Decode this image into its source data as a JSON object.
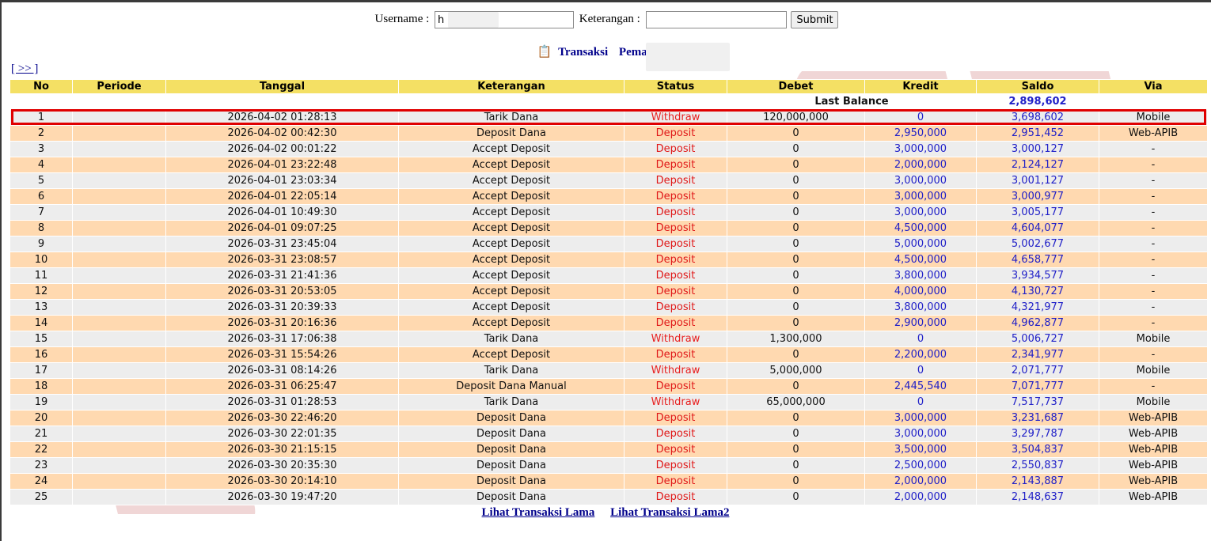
{
  "search": {
    "username_label": "Username :",
    "username_value": "h",
    "keterangan_label": "Keterangan :",
    "keterangan_value": "",
    "submit_label": "Submit"
  },
  "title": {
    "transaksi": "Transaksi",
    "pemain_label": "Pemain : h"
  },
  "nav": {
    "next_label": "[ >> ]"
  },
  "table": {
    "headers": [
      "No",
      "Periode",
      "Tanggal",
      "Keterangan",
      "Status",
      "Debet",
      "Kredit",
      "Saldo",
      "Via"
    ],
    "last_balance_label": "Last Balance",
    "last_balance_value": "2,898,602",
    "rows": [
      {
        "no": "1",
        "periode": "",
        "tanggal": "2026-04-02 01:28:13",
        "keterangan": "Tarik Dana",
        "status": "Withdraw",
        "debet": "120,000,000",
        "kredit": "0",
        "saldo": "3,698,602",
        "via": "Mobile"
      },
      {
        "no": "2",
        "periode": "",
        "tanggal": "2026-04-02 00:42:30",
        "keterangan": "Deposit Dana",
        "status": "Deposit",
        "debet": "0",
        "kredit": "2,950,000",
        "saldo": "2,951,452",
        "via": "Web-APIB"
      },
      {
        "no": "3",
        "periode": "",
        "tanggal": "2026-04-02 00:01:22",
        "keterangan": "Accept Deposit",
        "status": "Deposit",
        "debet": "0",
        "kredit": "3,000,000",
        "saldo": "3,000,127",
        "via": "-"
      },
      {
        "no": "4",
        "periode": "",
        "tanggal": "2026-04-01 23:22:48",
        "keterangan": "Accept Deposit",
        "status": "Deposit",
        "debet": "0",
        "kredit": "2,000,000",
        "saldo": "2,124,127",
        "via": "-"
      },
      {
        "no": "5",
        "periode": "",
        "tanggal": "2026-04-01 23:03:34",
        "keterangan": "Accept Deposit",
        "status": "Deposit",
        "debet": "0",
        "kredit": "3,000,000",
        "saldo": "3,001,127",
        "via": "-"
      },
      {
        "no": "6",
        "periode": "",
        "tanggal": "2026-04-01 22:05:14",
        "keterangan": "Accept Deposit",
        "status": "Deposit",
        "debet": "0",
        "kredit": "3,000,000",
        "saldo": "3,000,977",
        "via": "-"
      },
      {
        "no": "7",
        "periode": "",
        "tanggal": "2026-04-01 10:49:30",
        "keterangan": "Accept Deposit",
        "status": "Deposit",
        "debet": "0",
        "kredit": "3,000,000",
        "saldo": "3,005,177",
        "via": "-"
      },
      {
        "no": "8",
        "periode": "",
        "tanggal": "2026-04-01 09:07:25",
        "keterangan": "Accept Deposit",
        "status": "Deposit",
        "debet": "0",
        "kredit": "4,500,000",
        "saldo": "4,604,077",
        "via": "-"
      },
      {
        "no": "9",
        "periode": "",
        "tanggal": "2026-03-31 23:45:04",
        "keterangan": "Accept Deposit",
        "status": "Deposit",
        "debet": "0",
        "kredit": "5,000,000",
        "saldo": "5,002,677",
        "via": "-"
      },
      {
        "no": "10",
        "periode": "",
        "tanggal": "2026-03-31 23:08:57",
        "keterangan": "Accept Deposit",
        "status": "Deposit",
        "debet": "0",
        "kredit": "4,500,000",
        "saldo": "4,658,777",
        "via": "-"
      },
      {
        "no": "11",
        "periode": "",
        "tanggal": "2026-03-31 21:41:36",
        "keterangan": "Accept Deposit",
        "status": "Deposit",
        "debet": "0",
        "kredit": "3,800,000",
        "saldo": "3,934,577",
        "via": "-"
      },
      {
        "no": "12",
        "periode": "",
        "tanggal": "2026-03-31 20:53:05",
        "keterangan": "Accept Deposit",
        "status": "Deposit",
        "debet": "0",
        "kredit": "4,000,000",
        "saldo": "4,130,727",
        "via": "-"
      },
      {
        "no": "13",
        "periode": "",
        "tanggal": "2026-03-31 20:39:33",
        "keterangan": "Accept Deposit",
        "status": "Deposit",
        "debet": "0",
        "kredit": "3,800,000",
        "saldo": "4,321,977",
        "via": "-"
      },
      {
        "no": "14",
        "periode": "",
        "tanggal": "2026-03-31 20:16:36",
        "keterangan": "Accept Deposit",
        "status": "Deposit",
        "debet": "0",
        "kredit": "2,900,000",
        "saldo": "4,962,877",
        "via": "-"
      },
      {
        "no": "15",
        "periode": "",
        "tanggal": "2026-03-31 17:06:38",
        "keterangan": "Tarik Dana",
        "status": "Withdraw",
        "debet": "1,300,000",
        "kredit": "0",
        "saldo": "5,006,727",
        "via": "Mobile"
      },
      {
        "no": "16",
        "periode": "",
        "tanggal": "2026-03-31 15:54:26",
        "keterangan": "Accept Deposit",
        "status": "Deposit",
        "debet": "0",
        "kredit": "2,200,000",
        "saldo": "2,341,977",
        "via": "-"
      },
      {
        "no": "17",
        "periode": "",
        "tanggal": "2026-03-31 08:14:26",
        "keterangan": "Tarik Dana",
        "status": "Withdraw",
        "debet": "5,000,000",
        "kredit": "0",
        "saldo": "2,071,777",
        "via": "Mobile"
      },
      {
        "no": "18",
        "periode": "",
        "tanggal": "2026-03-31 06:25:47",
        "keterangan": "Deposit Dana Manual",
        "status": "Deposit",
        "debet": "0",
        "kredit": "2,445,540",
        "saldo": "7,071,777",
        "via": "-"
      },
      {
        "no": "19",
        "periode": "",
        "tanggal": "2026-03-31 01:28:53",
        "keterangan": "Tarik Dana",
        "status": "Withdraw",
        "debet": "65,000,000",
        "kredit": "0",
        "saldo": "7,517,737",
        "via": "Mobile"
      },
      {
        "no": "20",
        "periode": "",
        "tanggal": "2026-03-30 22:46:20",
        "keterangan": "Deposit Dana",
        "status": "Deposit",
        "debet": "0",
        "kredit": "3,000,000",
        "saldo": "3,231,687",
        "via": "Web-APIB"
      },
      {
        "no": "21",
        "periode": "",
        "tanggal": "2026-03-30 22:01:35",
        "keterangan": "Deposit Dana",
        "status": "Deposit",
        "debet": "0",
        "kredit": "3,000,000",
        "saldo": "3,297,787",
        "via": "Web-APIB"
      },
      {
        "no": "22",
        "periode": "",
        "tanggal": "2026-03-30 21:15:15",
        "keterangan": "Deposit Dana",
        "status": "Deposit",
        "debet": "0",
        "kredit": "3,500,000",
        "saldo": "3,504,837",
        "via": "Web-APIB"
      },
      {
        "no": "23",
        "periode": "",
        "tanggal": "2026-03-30 20:35:30",
        "keterangan": "Deposit Dana",
        "status": "Deposit",
        "debet": "0",
        "kredit": "2,500,000",
        "saldo": "2,550,837",
        "via": "Web-APIB"
      },
      {
        "no": "24",
        "periode": "",
        "tanggal": "2026-03-30 20:14:10",
        "keterangan": "Deposit Dana",
        "status": "Deposit",
        "debet": "0",
        "kredit": "2,000,000",
        "saldo": "2,143,887",
        "via": "Web-APIB"
      },
      {
        "no": "25",
        "periode": "",
        "tanggal": "2026-03-30 19:47:20",
        "keterangan": "Deposit Dana",
        "status": "Deposit",
        "debet": "0",
        "kredit": "2,000,000",
        "saldo": "2,148,637",
        "via": "Web-APIB"
      }
    ]
  },
  "footer": {
    "link1": "Lihat Transaksi Lama",
    "link2": "Lihat Transaksi Lama2"
  },
  "colors": {
    "header_bg": "#f4e064",
    "row_odd": "#ededed",
    "row_even": "#ffd9b0",
    "status_red": "#e01818",
    "amount_blue": "#2020c8",
    "title_navy": "#00008b",
    "highlight_red": "#e00000"
  }
}
